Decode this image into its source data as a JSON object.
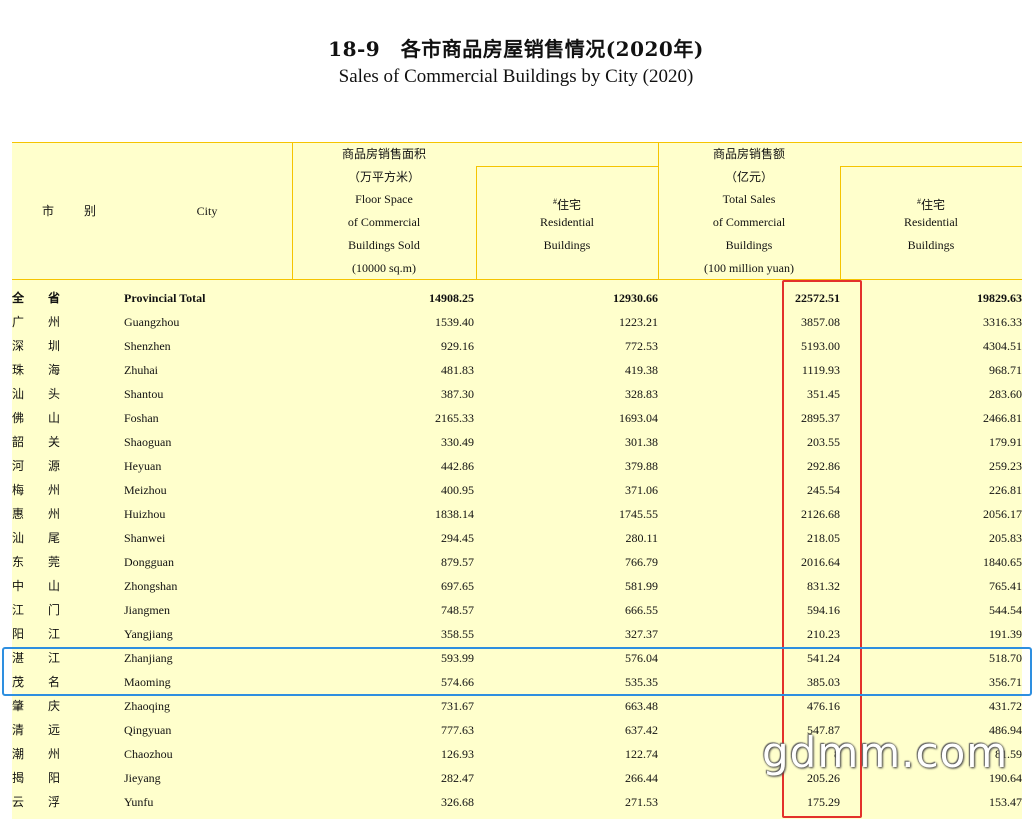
{
  "title": {
    "cn": "18-9　各市商品房屋销售情况(2020年)",
    "en": "Sales of Commercial Buildings by City (2020)"
  },
  "header": {
    "city_cn": "市　　别",
    "city_en": "City",
    "floor_cn": "商品房销售面积",
    "floor_unit_cn": "（万平方米）",
    "floor_en_1": "Floor Space",
    "floor_en_2": "of Commercial",
    "floor_en_3": "Buildings Sold",
    "floor_unit_en": "(10000 sq.m)",
    "res_mark": "#",
    "res_cn": "住宅",
    "res_en_1": "Residential",
    "res_en_2": "Buildings",
    "sales_cn": "商品房销售额",
    "sales_unit_cn": "（亿元）",
    "sales_en_1": "Total Sales",
    "sales_en_2": "of Commercial",
    "sales_en_3": "Buildings",
    "sales_unit_en": "(100 million yuan)"
  },
  "rows": [
    {
      "cn": "全省",
      "en": "Provincial Total",
      "floor": "14908.25",
      "floor_res": "12930.66",
      "sales": "22572.51",
      "sales_res": "19829.63"
    },
    {
      "cn": "广州",
      "en": "Guangzhou",
      "floor": "1539.40",
      "floor_res": "1223.21",
      "sales": "3857.08",
      "sales_res": "3316.33"
    },
    {
      "cn": "深圳",
      "en": "Shenzhen",
      "floor": "929.16",
      "floor_res": "772.53",
      "sales": "5193.00",
      "sales_res": "4304.51"
    },
    {
      "cn": "珠海",
      "en": "Zhuhai",
      "floor": "481.83",
      "floor_res": "419.38",
      "sales": "1119.93",
      "sales_res": "968.71"
    },
    {
      "cn": "汕头",
      "en": "Shantou",
      "floor": "387.30",
      "floor_res": "328.83",
      "sales": "351.45",
      "sales_res": "283.60"
    },
    {
      "cn": "佛山",
      "en": "Foshan",
      "floor": "2165.33",
      "floor_res": "1693.04",
      "sales": "2895.37",
      "sales_res": "2466.81"
    },
    {
      "cn": "韶关",
      "en": "Shaoguan",
      "floor": "330.49",
      "floor_res": "301.38",
      "sales": "203.55",
      "sales_res": "179.91"
    },
    {
      "cn": "河源",
      "en": "Heyuan",
      "floor": "442.86",
      "floor_res": "379.88",
      "sales": "292.86",
      "sales_res": "259.23"
    },
    {
      "cn": "梅州",
      "en": "Meizhou",
      "floor": "400.95",
      "floor_res": "371.06",
      "sales": "245.54",
      "sales_res": "226.81"
    },
    {
      "cn": "惠州",
      "en": "Huizhou",
      "floor": "1838.14",
      "floor_res": "1745.55",
      "sales": "2126.68",
      "sales_res": "2056.17"
    },
    {
      "cn": "汕尾",
      "en": "Shanwei",
      "floor": "294.45",
      "floor_res": "280.11",
      "sales": "218.05",
      "sales_res": "205.83"
    },
    {
      "cn": "东莞",
      "en": "Dongguan",
      "floor": "879.57",
      "floor_res": "766.79",
      "sales": "2016.64",
      "sales_res": "1840.65"
    },
    {
      "cn": "中山",
      "en": "Zhongshan",
      "floor": "697.65",
      "floor_res": "581.99",
      "sales": "831.32",
      "sales_res": "765.41"
    },
    {
      "cn": "江门",
      "en": "Jiangmen",
      "floor": "748.57",
      "floor_res": "666.55",
      "sales": "594.16",
      "sales_res": "544.54"
    },
    {
      "cn": "阳江",
      "en": "Yangjiang",
      "floor": "358.55",
      "floor_res": "327.37",
      "sales": "210.23",
      "sales_res": "191.39"
    },
    {
      "cn": "湛江",
      "en": "Zhanjiang",
      "floor": "593.99",
      "floor_res": "576.04",
      "sales": "541.24",
      "sales_res": "518.70"
    },
    {
      "cn": "茂名",
      "en": "Maoming",
      "floor": "574.66",
      "floor_res": "535.35",
      "sales": "385.03",
      "sales_res": "356.71"
    },
    {
      "cn": "肇庆",
      "en": "Zhaoqing",
      "floor": "731.67",
      "floor_res": "663.48",
      "sales": "476.16",
      "sales_res": "431.72"
    },
    {
      "cn": "清远",
      "en": "Qingyuan",
      "floor": "777.63",
      "floor_res": "637.42",
      "sales": "547.87",
      "sales_res": "486.94"
    },
    {
      "cn": "潮州",
      "en": "Chaozhou",
      "floor": "126.93",
      "floor_res": "122.74",
      "sales": "8",
      "sales_res": "81.59"
    },
    {
      "cn": "揭阳",
      "en": "Jieyang",
      "floor": "282.47",
      "floor_res": "266.44",
      "sales": "205.26",
      "sales_res": "190.64"
    },
    {
      "cn": "云浮",
      "en": "Yunfu",
      "floor": "326.68",
      "floor_res": "271.53",
      "sales": "175.29",
      "sales_res": "153.47"
    }
  ],
  "watermark": "gdmm.com",
  "colors": {
    "table_bg": "#ffffcc",
    "rule": "#f5c400",
    "highlight_red": "#e3312b",
    "highlight_blue": "#2e8fe0"
  }
}
